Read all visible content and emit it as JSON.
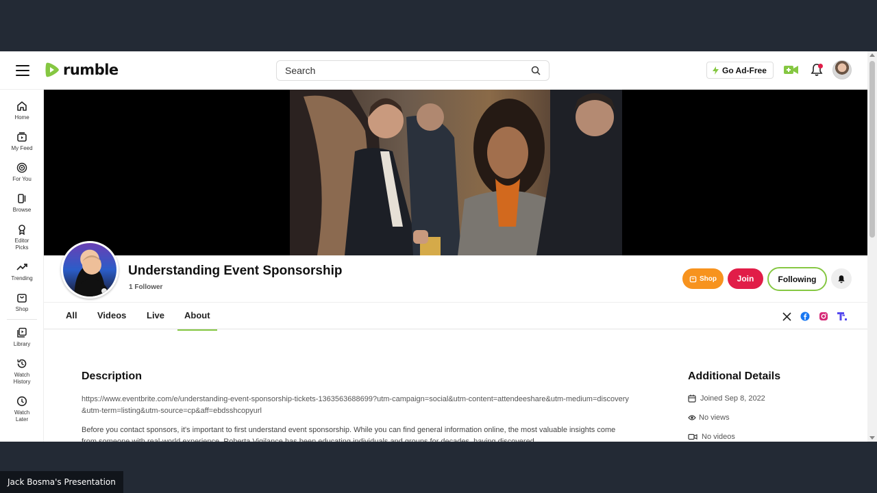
{
  "header": {
    "logo_text": "rumble",
    "search_placeholder": "Search",
    "ad_free_label": "Go Ad-Free",
    "brand_color": "#85c742"
  },
  "sidebar": {
    "items": [
      {
        "label": "Home",
        "icon": "home-icon"
      },
      {
        "label": "My Feed",
        "icon": "feed-icon"
      },
      {
        "label": "For You",
        "icon": "target-icon"
      },
      {
        "label": "Browse",
        "icon": "browse-icon"
      },
      {
        "label": "Editor Picks",
        "icon": "award-icon"
      },
      {
        "label": "Trending",
        "icon": "trending-icon"
      },
      {
        "label": "Shop",
        "icon": "shop-icon"
      },
      {
        "label": "Library",
        "icon": "library-icon"
      },
      {
        "label": "Watch History",
        "icon": "history-icon"
      },
      {
        "label": "Watch Later",
        "icon": "clock-icon"
      }
    ]
  },
  "channel": {
    "title": "Understanding Event Sponsorship",
    "followers": "1 Follower",
    "shop_label": "Shop",
    "join_label": "Join",
    "following_label": "Following"
  },
  "tabs": [
    {
      "label": "All",
      "active": false
    },
    {
      "label": "Videos",
      "active": false
    },
    {
      "label": "Live",
      "active": false
    },
    {
      "label": "About",
      "active": true
    }
  ],
  "about": {
    "description_title": "Description",
    "description_link": "https://www.eventbrite.com/e/understanding-event-sponsorship-tickets-1363563688699?utm-campaign=social&utm-content=attendeeshare&utm-medium=discovery&utm-term=listing&utm-source=cp&aff=ebdsshcopyurl",
    "description_text": "Before you contact sponsors, it's important to first understand event sponsorship. While you can find general information online, the most valuable insights come from someone with real-world experience. Roberta Vigilance has been educating individuals and groups for decades, having discovered",
    "details_title": "Additional Details",
    "joined": "Joined Sep 8, 2022",
    "views": "No views",
    "videos": "No videos"
  },
  "presenter_label": "Jack Bosma's Presentation",
  "colors": {
    "shop": "#f7931e",
    "join": "#e11d48",
    "accent_green": "#85c742"
  }
}
